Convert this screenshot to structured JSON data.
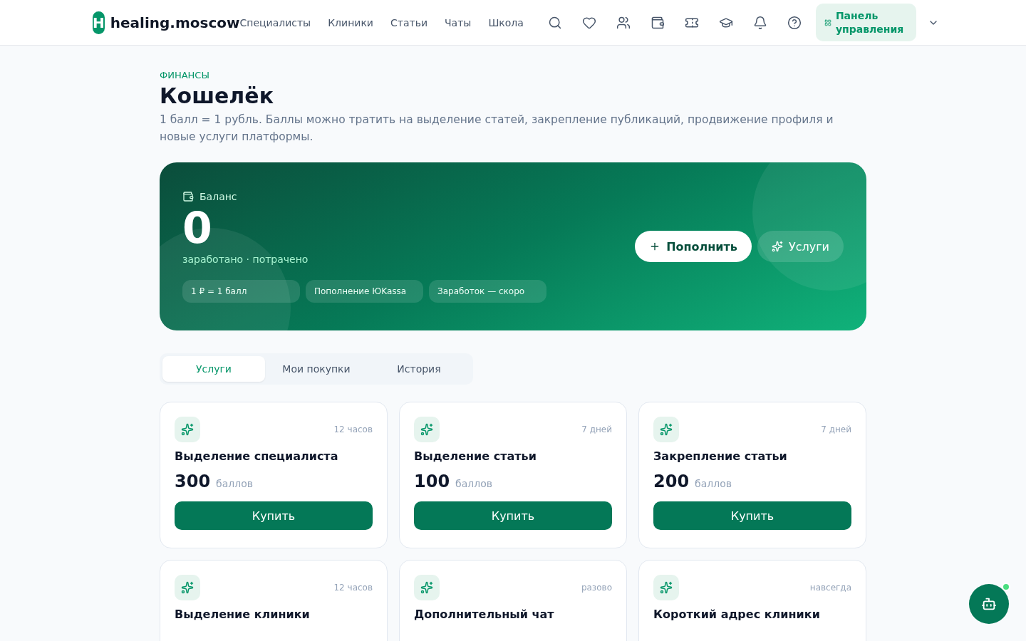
{
  "header": {
    "logo_letter": "H",
    "site_name": "healing.moscow",
    "nav": [
      "Специалисты",
      "Клиники",
      "Статьи",
      "Чаты",
      "Школа"
    ],
    "dashboard_button": "Панель управления"
  },
  "page": {
    "eyebrow": "ФИНАНСЫ",
    "title": "Кошелёк",
    "description": "1 балл = 1 рубль. Баллы можно тратить на выделение статей, закрепление публикаций, продвижение профиля и новые услуги платформы."
  },
  "balance": {
    "label": "Баланс",
    "amount": "0",
    "subtitle": "заработано · потрачено",
    "chips": [
      "1 ₽ = 1 балл",
      "Пополнение ЮKassa",
      "Заработок — скоро"
    ],
    "topup_button": "Пополнить",
    "services_button": "Услуги"
  },
  "tabs": [
    {
      "label": "Услуги",
      "selected": true
    },
    {
      "label": "Мои покупки",
      "selected": false
    },
    {
      "label": "История",
      "selected": false
    }
  ],
  "services": [
    {
      "duration": "12 часов",
      "title": "Выделение специалиста",
      "price": "300",
      "unit": "баллов",
      "button": "Купить"
    },
    {
      "duration": "7 дней",
      "title": "Выделение статьи",
      "price": "100",
      "unit": "баллов",
      "button": "Купить"
    },
    {
      "duration": "7 дней",
      "title": "Закрепление статьи",
      "price": "200",
      "unit": "баллов",
      "button": "Купить"
    },
    {
      "duration": "12 часов",
      "title": "Выделение клиники"
    },
    {
      "duration": "разово",
      "title": "Дополнительный чат"
    },
    {
      "duration": "навсегда",
      "title": "Короткий адрес клиники"
    }
  ],
  "assistant": {
    "online": true
  }
}
